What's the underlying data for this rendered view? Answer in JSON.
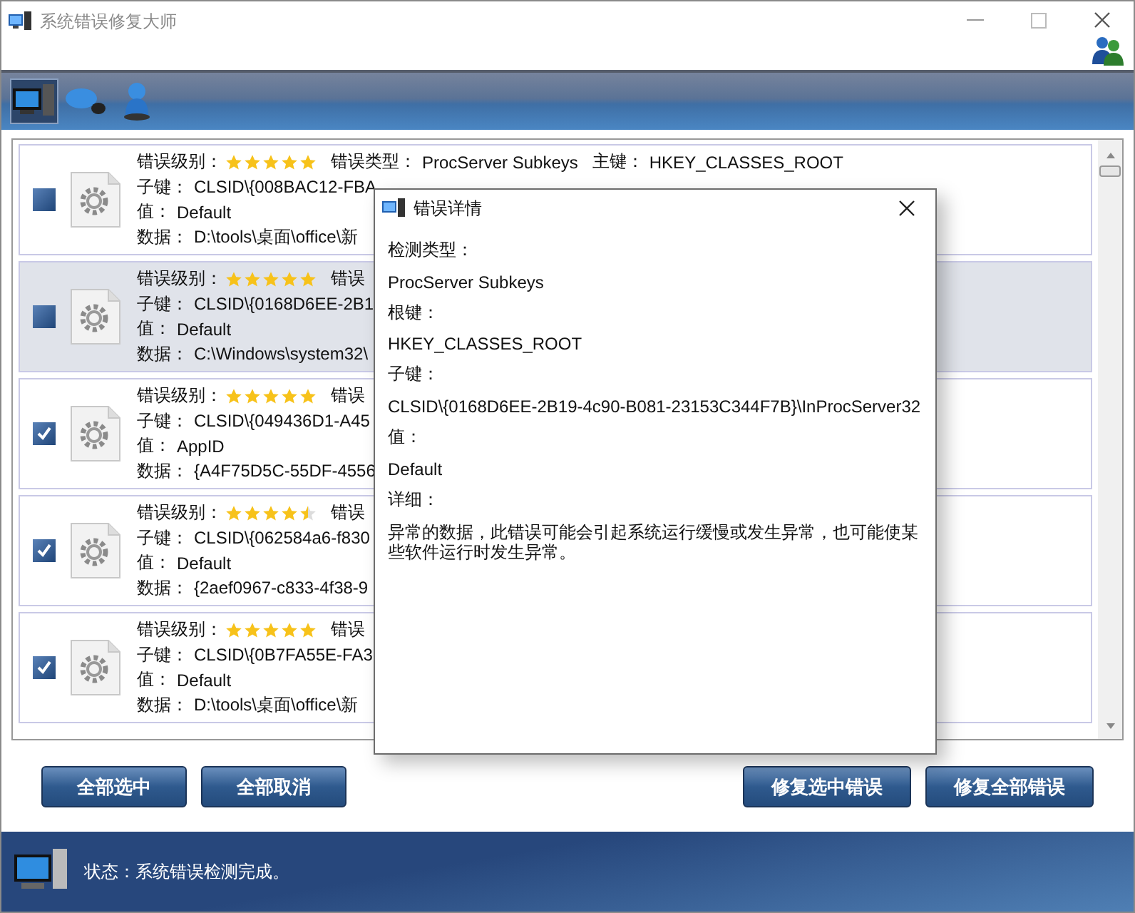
{
  "window": {
    "title": "系统错误修复大师"
  },
  "toolbar": [
    {
      "selected": true
    },
    {
      "selected": false
    },
    {
      "selected": false
    }
  ],
  "rows": [
    {
      "checked": false,
      "selected": false,
      "level_label": "错误级别：",
      "stars": 5,
      "type_label": "错误类型：",
      "type": "ProcServer Subkeys",
      "root_label": "主键：",
      "root": "HKEY_CLASSES_ROOT",
      "subkey_label": "子键：",
      "subkey": "CLSID\\{008BAC12-FBA",
      "value_label": "值：",
      "value": "Default",
      "data_label": "数据：",
      "data": "D:\\tools\\桌面\\office\\新"
    },
    {
      "checked": false,
      "selected": true,
      "level_label": "错误级别：",
      "stars": 5,
      "type_label": "错误",
      "subkey_label": "子键：",
      "subkey": "CLSID\\{0168D6EE-2B1",
      "value_label": "值：",
      "value": "Default",
      "data_label": "数据：",
      "data": "C:\\Windows\\system32\\"
    },
    {
      "checked": true,
      "selected": false,
      "level_label": "错误级别：",
      "stars": 5,
      "type_label": "错误",
      "subkey_label": "子键：",
      "subkey": "CLSID\\{049436D1-A45",
      "value_label": "值：",
      "value": "AppID",
      "data_label": "数据：",
      "data": "{A4F75D5C-55DF-4556"
    },
    {
      "checked": true,
      "selected": false,
      "level_label": "错误级别：",
      "stars": 4.5,
      "type_label": "错误",
      "subkey_label": "子键：",
      "subkey": "CLSID\\{062584a6-f830",
      "value_label": "值：",
      "value": "Default",
      "data_label": "数据：",
      "data": "{2aef0967-c833-4f38-9"
    },
    {
      "checked": true,
      "selected": false,
      "level_label": "错误级别：",
      "stars": 5,
      "type_label": "错误",
      "subkey_label": "子键：",
      "subkey": "CLSID\\{0B7FA55E-FA3",
      "value_label": "值：",
      "value": "Default",
      "data_label": "数据：",
      "data": "D:\\tools\\桌面\\office\\新"
    }
  ],
  "buttons_left": [
    "全部选中",
    "全部取消"
  ],
  "buttons_right": [
    "修复选中错误",
    "修复全部错误"
  ],
  "status_bar": {
    "text": "状态：系统错误检测完成。"
  },
  "dialog": {
    "title": "错误详情",
    "fields": [
      {
        "label": "检测类型：",
        "value": "ProcServer Subkeys"
      },
      {
        "label": "根键：",
        "value": "HKEY_CLASSES_ROOT"
      },
      {
        "label": "子键：",
        "value": "CLSID\\{0168D6EE-2B19-4c90-B081-23153C344F7B}\\InProcServer32"
      },
      {
        "label": "值：",
        "value": "Default"
      },
      {
        "label": "详细：",
        "value": "异常的数据，此错误可能会引起系统运行缓慢或发生异常，也可能使某些软件运行时发生异常。"
      }
    ]
  }
}
